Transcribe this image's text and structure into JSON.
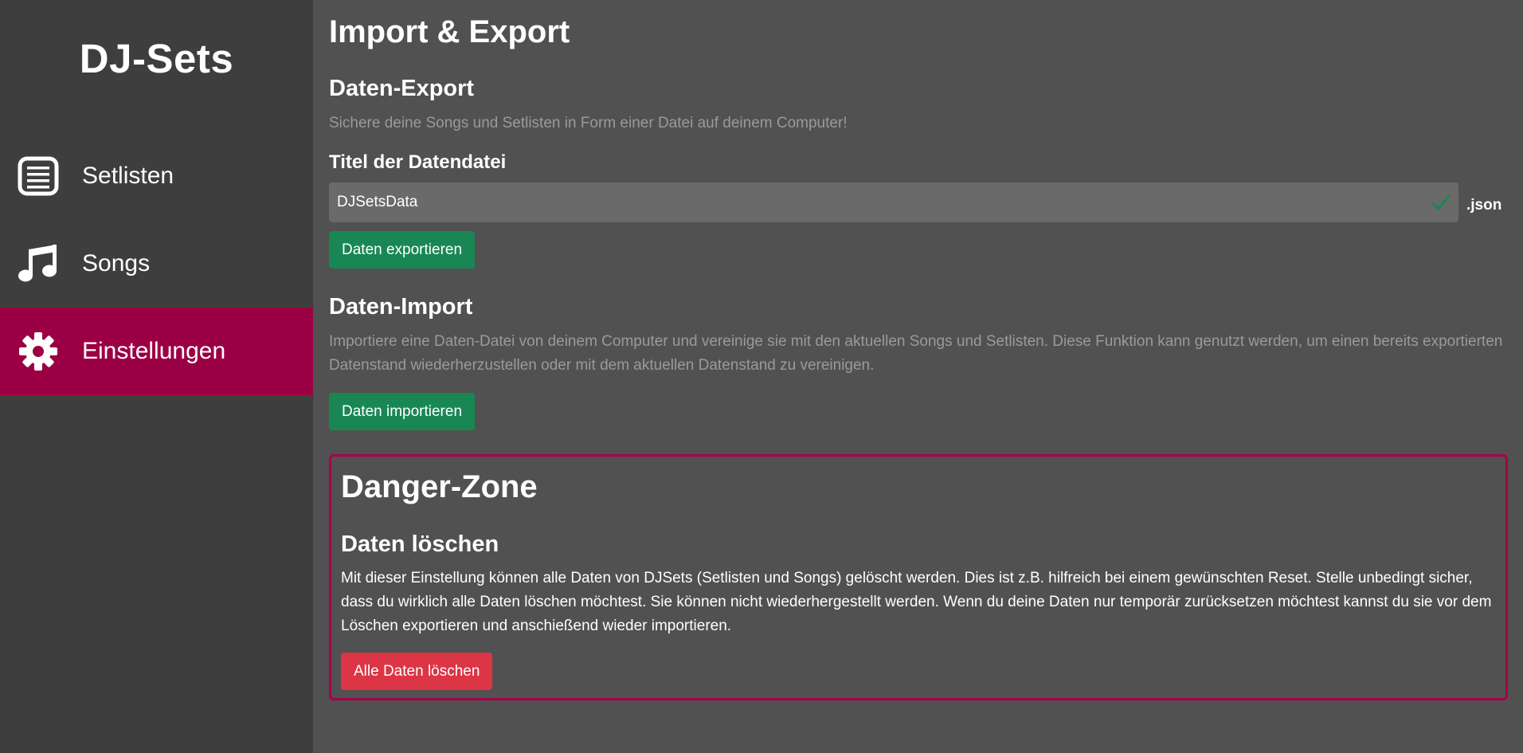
{
  "app": {
    "brand": "DJ-Sets"
  },
  "sidebar": {
    "items": [
      {
        "label": "Setlisten",
        "icon": "list-icon"
      },
      {
        "label": "Songs",
        "icon": "music-note-icon"
      },
      {
        "label": "Einstellungen",
        "icon": "gear-icon",
        "active": true
      }
    ]
  },
  "main": {
    "title": "Import & Export",
    "export": {
      "heading": "Daten-Export",
      "description": "Sichere deine Songs und Setlisten in Form einer Datei auf deinem Computer!",
      "field_label": "Titel der Datendatei",
      "filename_value": "DJSetsData",
      "suffix": ".json",
      "button": "Daten exportieren"
    },
    "import": {
      "heading": "Daten-Import",
      "description": "Importiere eine Daten-Datei von deinem Computer und vereinige sie mit den aktuellen Songs und Setlisten. Diese Funktion kann genutzt werden, um einen bereits exportierten Datenstand wiederherzustellen oder mit dem aktuellen Datenstand zu vereinigen.",
      "button": "Daten importieren"
    },
    "danger": {
      "title": "Danger-Zone",
      "subheading": "Daten löschen",
      "text": "Mit dieser Einstellung können alle Daten von DJSets (Setlisten und Songs) gelöscht werden. Dies ist z.B. hilfreich bei einem gewünschten Reset. Stelle unbedingt sicher, dass du wirklich alle Daten löschen möchtest. Sie können nicht wiederhergestellt werden. Wenn du deine Daten nur temporär zurücksetzen möchtest kannst du sie vor dem Löschen exportieren und anschießend wieder importieren.",
      "button": "Alle Daten löschen"
    }
  },
  "colors": {
    "sidebar_bg": "#3e3e3e",
    "main_bg": "#515151",
    "accent": "#9c0044",
    "success": "#198754",
    "danger": "#dc3545",
    "check": "#198754"
  }
}
